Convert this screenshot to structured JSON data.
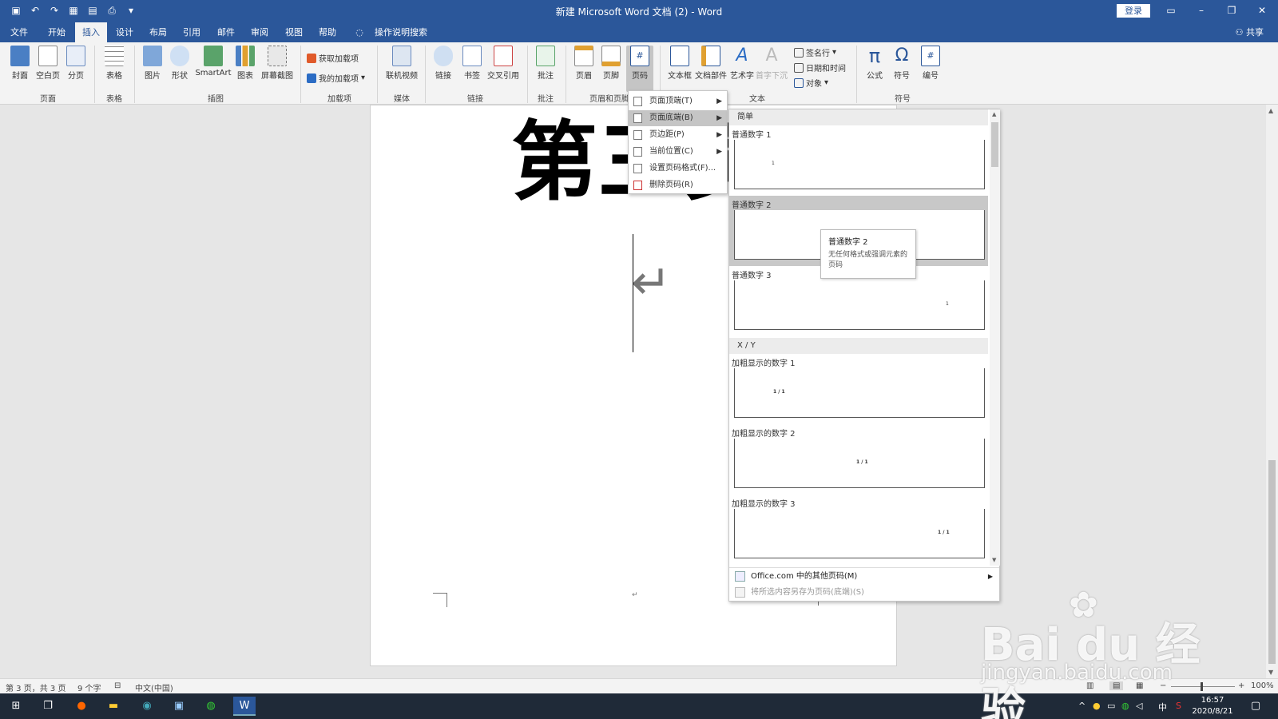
{
  "window": {
    "title": "新建 Microsoft Word 文档 (2)  -  Word",
    "login": "登录"
  },
  "tabs": [
    {
      "label": "文件"
    },
    {
      "label": "开始"
    },
    {
      "label": "插入"
    },
    {
      "label": "设计"
    },
    {
      "label": "布局"
    },
    {
      "label": "引用"
    },
    {
      "label": "邮件"
    },
    {
      "label": "审阅"
    },
    {
      "label": "视图"
    },
    {
      "label": "帮助"
    },
    {
      "label": "操作说明搜索"
    }
  ],
  "share": "共享",
  "ribbon": {
    "buttons": [
      {
        "label": "封面"
      },
      {
        "label": "空白页"
      },
      {
        "label": "分页"
      },
      {
        "label": "表格"
      },
      {
        "label": "图片"
      },
      {
        "label": "形状"
      },
      {
        "label": "SmartArt"
      },
      {
        "label": "图表"
      },
      {
        "label": "屏幕截图"
      },
      {
        "label": "联机视频"
      },
      {
        "label": "链接"
      },
      {
        "label": "书签"
      },
      {
        "label": "交叉引用"
      },
      {
        "label": "批注"
      },
      {
        "label": "页眉"
      },
      {
        "label": "页脚"
      },
      {
        "label": "页码"
      },
      {
        "label": "文本框"
      },
      {
        "label": "文档部件"
      },
      {
        "label": "艺术字"
      },
      {
        "label": "首字下沉"
      },
      {
        "label": "公式"
      },
      {
        "label": "符号"
      },
      {
        "label": "编号"
      }
    ],
    "small": {
      "get_addins": "获取加载项",
      "my_addins": "我的加载项",
      "signature": "签名行",
      "datetime": "日期和时间",
      "object": "对象"
    },
    "groups": [
      {
        "label": "页面"
      },
      {
        "label": "表格"
      },
      {
        "label": "插图"
      },
      {
        "label": "加载项"
      },
      {
        "label": "媒体"
      },
      {
        "label": "链接"
      },
      {
        "label": "批注"
      },
      {
        "label": "页眉和页脚"
      },
      {
        "label": "文本"
      },
      {
        "label": "符号"
      }
    ]
  },
  "document": {
    "heading": "第三页"
  },
  "page_number_menu": {
    "items": [
      {
        "label": "页面顶端(T)"
      },
      {
        "label": "页面底端(B)"
      },
      {
        "label": "页边距(P)"
      },
      {
        "label": "当前位置(C)"
      },
      {
        "label": "设置页码格式(F)..."
      },
      {
        "label": "删除页码(R)"
      }
    ]
  },
  "gallery": {
    "cat_simple": "简单",
    "cat_xy": "X / Y",
    "items": [
      {
        "label": "普通数字 1",
        "sample": "1"
      },
      {
        "label": "普通数字 2",
        "sample": "1"
      },
      {
        "label": "普通数字 3",
        "sample": "1"
      },
      {
        "label": "加粗显示的数字 1",
        "sample": "1 / 1"
      },
      {
        "label": "加粗显示的数字 2",
        "sample": "1 / 1"
      },
      {
        "label": "加粗显示的数字 3",
        "sample": "1 / 1"
      }
    ],
    "more": "Office.com 中的其他页码(M)",
    "save": "将所选内容另存为页码(底端)(S)"
  },
  "tooltip": {
    "title": "普通数字 2",
    "desc": "无任何格式或强调元素的页码"
  },
  "status": {
    "page": "第 3 页，共 3 页",
    "words": "9 个字",
    "lang": "中文(中国)",
    "zoom": "100%"
  },
  "taskbar": {
    "ime": "中",
    "time": "16:57",
    "date": "2020/8/21"
  },
  "watermark": {
    "brand": "Bai du 经验",
    "url": "jingyan.baidu.com"
  },
  "colors": {
    "accent": "#2b579a",
    "taskbar": "#1f2a38"
  }
}
